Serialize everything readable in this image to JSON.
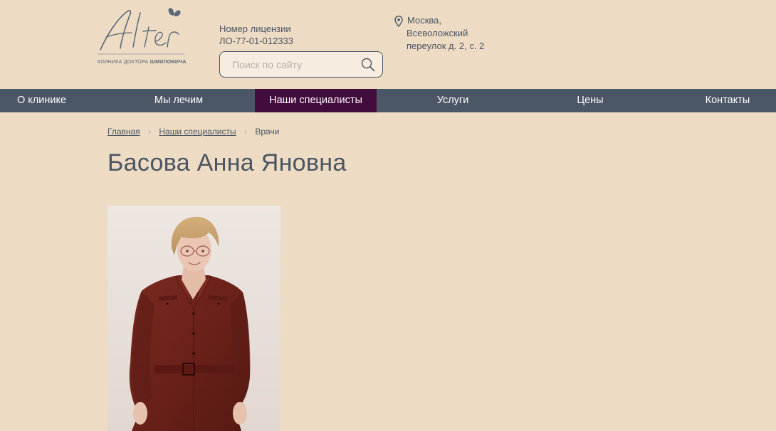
{
  "logo": {
    "wordmark": "Alter",
    "subtitle_prefix": "КЛИНИКА ДОКТОРА ",
    "subtitle_name": "ШМИЛОВИЧА"
  },
  "license": {
    "label": "Номер лицензии",
    "number": "ЛО-77-01-012333"
  },
  "search": {
    "placeholder": "Поиск по сайту",
    "value": ""
  },
  "address": {
    "line1": "Москва,",
    "line2": "Всеволожский",
    "line3": "переулок д. 2, с. 2"
  },
  "nav": {
    "items": [
      {
        "label": "О клинике"
      },
      {
        "label": "Мы лечим"
      },
      {
        "label": "Наши специалисты",
        "active": true
      },
      {
        "label": "Услуги"
      },
      {
        "label": "Цены"
      },
      {
        "label": "Контакты"
      }
    ]
  },
  "breadcrumb": {
    "home": "Главная",
    "section": "Наши специалисты",
    "current": "Врачи",
    "separator": "›"
  },
  "page": {
    "title": "Басова Анна Яновна"
  },
  "colors": {
    "background": "#eddbc4",
    "nav_bg": "#4b5667",
    "nav_active": "#420c3d",
    "text": "#4a5563"
  }
}
